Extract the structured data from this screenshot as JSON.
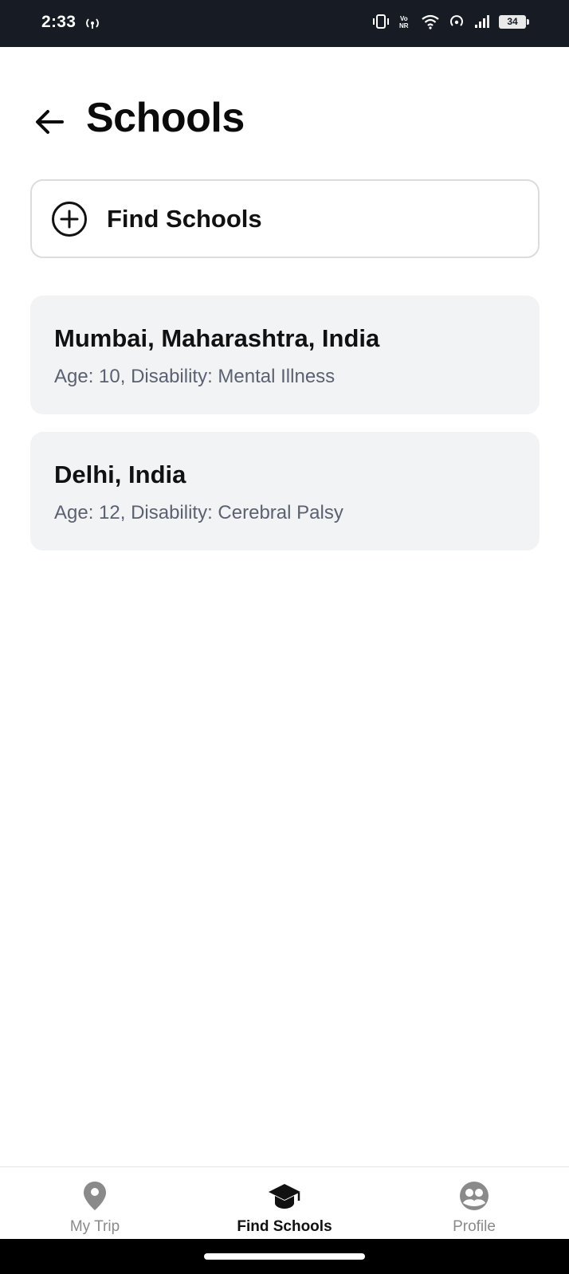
{
  "status_bar": {
    "time": "2:33",
    "battery": "34"
  },
  "header": {
    "title": "Schools",
    "back_icon": "arrow-left-icon"
  },
  "find_button": {
    "label": "Find Schools",
    "icon": "plus-circle-icon"
  },
  "searches": [
    {
      "location": "Mumbai, Maharashtra, India",
      "details": "Age: 10, Disability: Mental Illness"
    },
    {
      "location": "Delhi, India",
      "details": "Age: 12, Disability: Cerebral Palsy"
    }
  ],
  "bottom_nav": {
    "items": [
      {
        "label": "My Trip",
        "icon": "map-pin-icon",
        "active": false
      },
      {
        "label": "Find Schools",
        "icon": "graduation-cap-icon",
        "active": true
      },
      {
        "label": "Profile",
        "icon": "profile-group-icon",
        "active": false
      }
    ]
  },
  "colors": {
    "status_bar_bg": "#161b24",
    "card_bg": "#f2f3f5",
    "inactive_nav": "#8a8a8a",
    "active_nav": "#111111",
    "secondary_text": "#5b6170"
  }
}
